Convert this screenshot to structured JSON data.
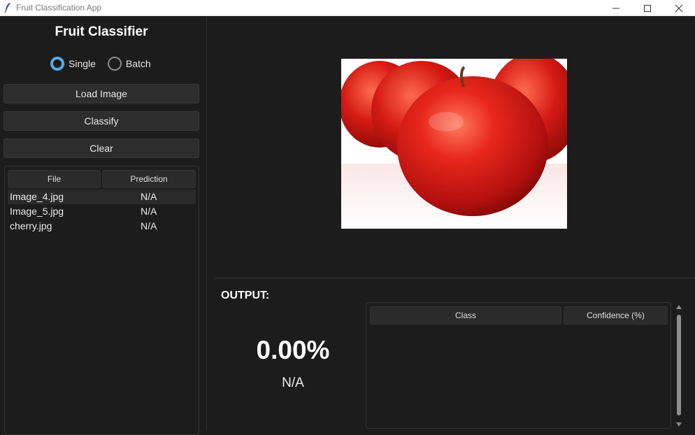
{
  "window": {
    "title": "Fruit Classification App",
    "controls": [
      "minimize",
      "maximize",
      "close"
    ]
  },
  "sidebar": {
    "heading": "Fruit Classifier",
    "mode": {
      "options": [
        {
          "label": "Single",
          "selected": true
        },
        {
          "label": "Batch",
          "selected": false
        }
      ]
    },
    "buttons": {
      "load": "Load Image",
      "classify": "Classify",
      "clear": "Clear"
    },
    "file_table": {
      "columns": [
        "File",
        "Prediction"
      ],
      "rows": [
        {
          "file": "Image_4.jpg",
          "prediction": "N/A",
          "selected": true
        },
        {
          "file": "Image_5.jpg",
          "prediction": "N/A",
          "selected": false
        },
        {
          "file": "cherry.jpg",
          "prediction": "N/A",
          "selected": false
        }
      ]
    }
  },
  "main": {
    "preview_image": "red-apples-photo",
    "output": {
      "label": "OUTPUT:",
      "confidence": "0.00%",
      "predicted_class": "N/A"
    },
    "result_table": {
      "columns": [
        "Class",
        "Confidence (%)"
      ],
      "rows": []
    }
  },
  "colors": {
    "background": "#1c1c1c",
    "button": "#2d2d2d",
    "accent": "#5aa9e6",
    "text": "#ffffff"
  }
}
